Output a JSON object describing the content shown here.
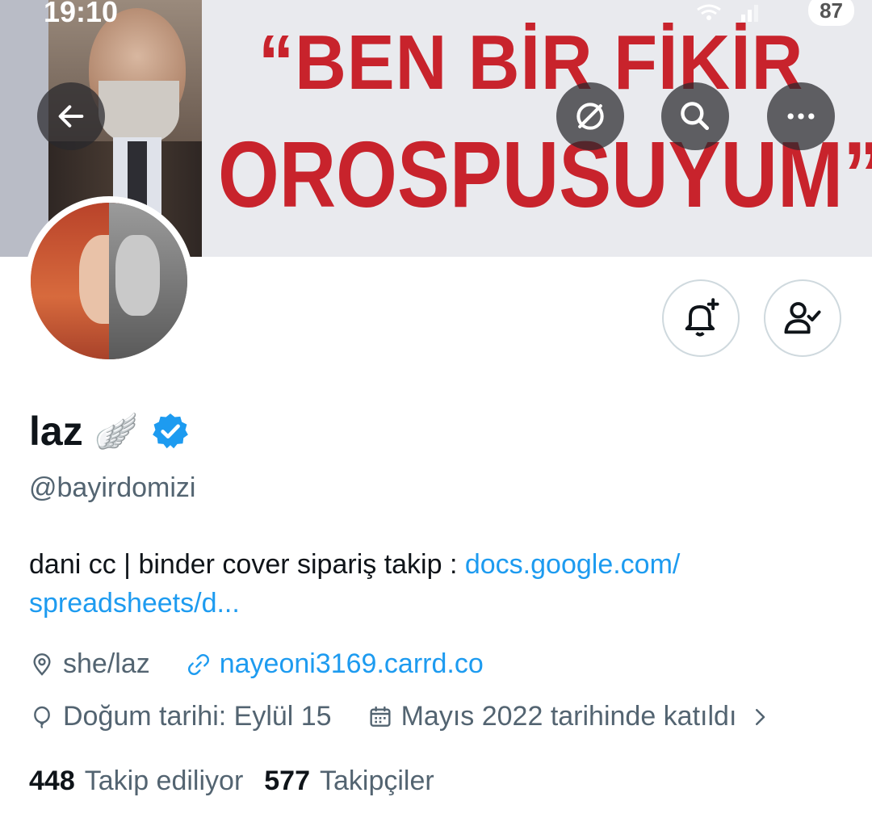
{
  "status_bar": {
    "time": "19:10",
    "battery": "87"
  },
  "banner": {
    "line1": "“BEN BİR FİKİR",
    "line2": "OROSPUSUYUM”"
  },
  "profile": {
    "display_name": "laz",
    "name_emoji": "🪽",
    "handle": "@bayirdomizi",
    "bio_text": "dani cc | binder cover sipariş takip : ",
    "bio_link_line1": "docs.google.com/",
    "bio_link_line2": "spreadsheets/d...",
    "location": "she/laz",
    "website": "nayeoni3169.carrd.co",
    "birthday": "Doğum tarihi: Eylül 15",
    "joined": "Mayıs 2022 tarihinde katıldı",
    "following_count": "448",
    "following_label": "Takip ediliyor",
    "followers_count": "577",
    "followers_label": "Takipçiler"
  },
  "colors": {
    "accent": "#1d9bf0",
    "secondary_text": "#536471",
    "banner_text": "#c8232c",
    "verified": "#1d9bf0"
  },
  "icons": [
    "back-arrow-icon",
    "grok-icon",
    "search-icon",
    "more-icon",
    "notification-bell-plus-icon",
    "following-person-check-icon",
    "verified-badge-icon",
    "location-icon",
    "link-icon",
    "birthday-balloon-icon",
    "calendar-icon",
    "chevron-right-icon"
  ]
}
